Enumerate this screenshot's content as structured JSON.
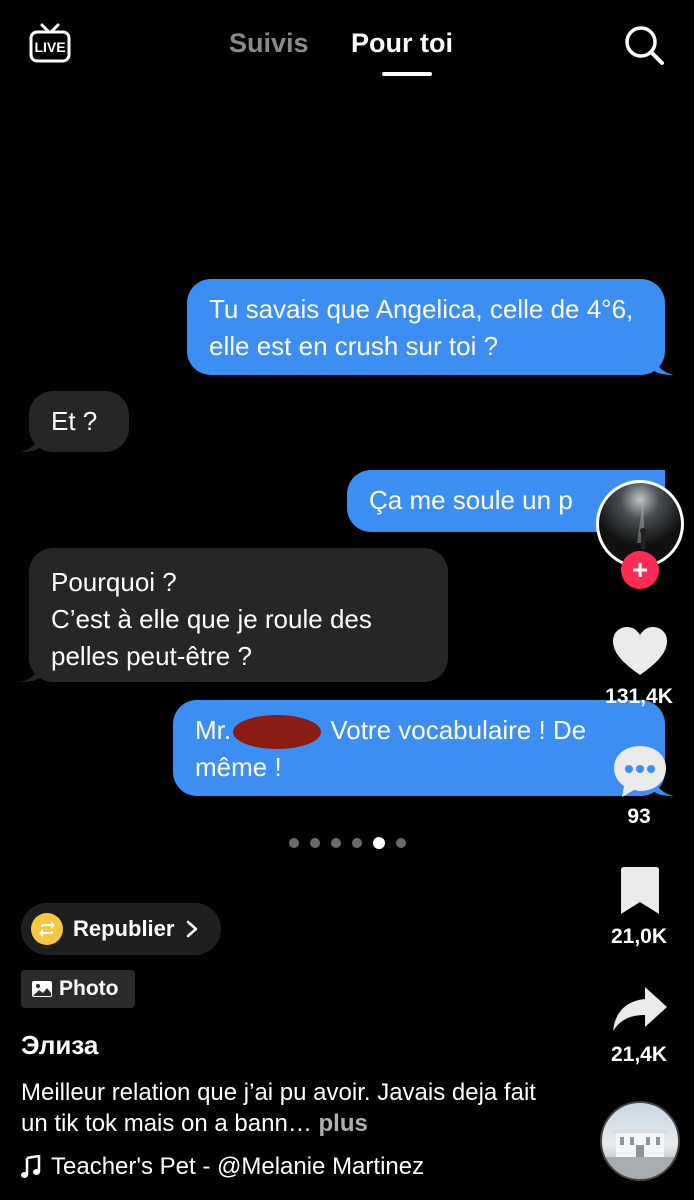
{
  "header": {
    "live_label": "LIVE",
    "tabs": [
      {
        "label": "Suivis",
        "active": false
      },
      {
        "label": "Pour toi",
        "active": true
      }
    ]
  },
  "messages": [
    {
      "side": "sent",
      "text": "Tu savais que Angelica, celle de 4°6, elle est en crush sur toi ?"
    },
    {
      "side": "received",
      "text": "Et ?"
    },
    {
      "side": "sent",
      "text": "Ça me soule un p"
    },
    {
      "side": "received",
      "lines": [
        "Pourquoi ?",
        "C’est à elle que je roule des",
        "pelles peut-être ?"
      ]
    },
    {
      "side": "sent",
      "text_before": "Mr.",
      "text_after": " Votre vocabulaire ! De",
      "line2": "même !"
    }
  ],
  "carousel": {
    "count": 6,
    "active_index": 4
  },
  "rail": {
    "likes": "131,4K",
    "comments": "93",
    "saves": "21,0K",
    "shares": "21,4K"
  },
  "repost": {
    "label": "Republier"
  },
  "photo_badge": {
    "label": "Photo"
  },
  "post": {
    "username": "Элиза",
    "caption": "Meilleur relation que j’ai pu avoir.  Javais deja fait un tik tok mais on a bann…",
    "more_label": "plus",
    "music": "Teacher's Pet - @Melanie Martinez"
  },
  "colors": {
    "sent_bubble": "#3d8ef3",
    "received_bubble": "#262628",
    "follow_accent": "#fe2c55",
    "repost_accent": "#f5c742"
  }
}
